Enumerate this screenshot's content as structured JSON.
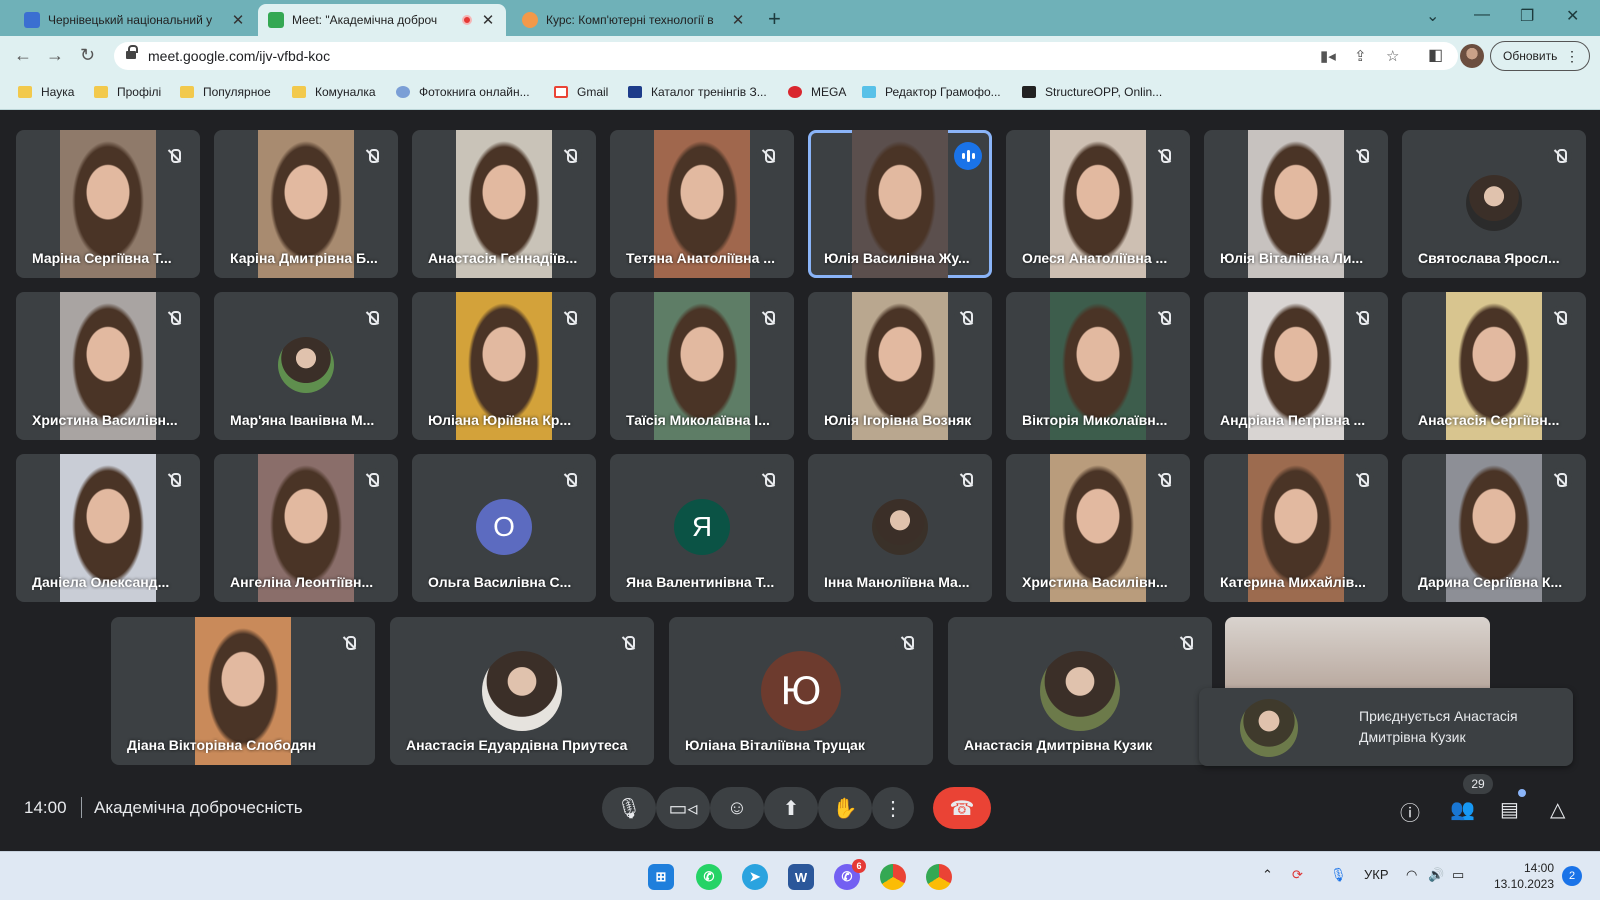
{
  "browser": {
    "tabs": [
      {
        "label": "Чернівецький національний у",
        "favicon_color": "#3b6fd1"
      },
      {
        "label": "Meet: \"Академічна доброч",
        "favicon_color": "#34a853",
        "recording": true
      },
      {
        "label": "Курс: Комп'ютерні технології в",
        "favicon_color": "#f2994a"
      }
    ],
    "url": "meet.google.com/ijv-vfbd-koc",
    "update_label": "Обновить",
    "bookmarks": [
      {
        "label": "Наука",
        "icon": "folder-icon"
      },
      {
        "label": "Профілі",
        "icon": "folder-icon"
      },
      {
        "label": "Популярное",
        "icon": "folder-icon"
      },
      {
        "label": "Комуналка",
        "icon": "folder-icon"
      },
      {
        "label": "Фотокнига онлайн...",
        "icon": "photobook-icon"
      },
      {
        "label": "Gmail",
        "icon": "gmail-icon"
      },
      {
        "label": "Каталог тренінгів З...",
        "icon": "catalog-icon"
      },
      {
        "label": "MEGA",
        "icon": "mega-icon"
      },
      {
        "label": "Редактор Грамофо...",
        "icon": "editor-icon"
      },
      {
        "label": "StructureOPP, Onlin...",
        "icon": "structure-icon"
      }
    ]
  },
  "participants": [
    {
      "name": "Маріна Сергіївна Т...",
      "muted": true,
      "kind": "video",
      "tone": "#8f7a6a"
    },
    {
      "name": "Каріна Дмитрівна Б...",
      "muted": true,
      "kind": "video",
      "tone": "#a88b70"
    },
    {
      "name": "Анастасія Геннадіїв...",
      "muted": true,
      "kind": "video",
      "tone": "#c9c3b8"
    },
    {
      "name": "Тетяна Анатоліївна ...",
      "muted": true,
      "kind": "video",
      "tone": "#a0674d"
    },
    {
      "name": "Юлія Василівна Жу...",
      "muted": false,
      "speaking": true,
      "kind": "video",
      "tone": "#5b4f4d"
    },
    {
      "name": "Олеся Анатоліївна ...",
      "muted": true,
      "kind": "video",
      "tone": "#cdbfb2"
    },
    {
      "name": "Юлія Віталіївна Ли...",
      "muted": true,
      "kind": "video",
      "tone": "#c7c2bf"
    },
    {
      "name": "Святослава Яросл...",
      "muted": true,
      "kind": "photo-avatar",
      "tone": "#2b2b2b"
    },
    {
      "name": "Христина Василівн...",
      "muted": true,
      "kind": "video",
      "tone": "#a9a4a2"
    },
    {
      "name": "Мар'яна Іванівна М...",
      "muted": true,
      "kind": "photo-avatar",
      "tone": "#5f8f4e"
    },
    {
      "name": "Юліана Юріївна Кр...",
      "muted": true,
      "kind": "video",
      "tone": "#d3a23a"
    },
    {
      "name": "Таїсія Миколаївна І...",
      "muted": true,
      "kind": "video",
      "tone": "#5e7d66"
    },
    {
      "name": "Юлія Ігорівна Возняк",
      "muted": true,
      "kind": "video",
      "tone": "#b9a78f"
    },
    {
      "name": "Вікторія Миколаївн...",
      "muted": true,
      "kind": "video",
      "tone": "#3d5d4c"
    },
    {
      "name": "Андріана Петрівна ...",
      "muted": true,
      "kind": "video",
      "tone": "#d8d4d2"
    },
    {
      "name": "Анастасія Сергіївн...",
      "muted": true,
      "kind": "video",
      "tone": "#d8c58f"
    },
    {
      "name": "Даніела Олександ...",
      "muted": true,
      "kind": "video",
      "tone": "#c9cdd6"
    },
    {
      "name": "Ангеліна Леонтіївн...",
      "muted": true,
      "kind": "video",
      "tone": "#8a6e6a"
    },
    {
      "name": "Ольга Василівна С...",
      "muted": true,
      "kind": "letter",
      "letter": "О",
      "color": "#5c6bc0"
    },
    {
      "name": "Яна Валентинівна Т...",
      "muted": true,
      "kind": "letter",
      "letter": "Я",
      "color": "#0b5345"
    },
    {
      "name": "Інна Маноліївна Ма...",
      "muted": true,
      "kind": "photo-avatar",
      "tone": "#3a3129"
    },
    {
      "name": "Христина Василівн...",
      "muted": true,
      "kind": "video",
      "tone": "#b99c7c"
    },
    {
      "name": "Катерина Михайлів...",
      "muted": true,
      "kind": "video",
      "tone": "#9c6b4f"
    },
    {
      "name": "Дарина Сергіївна К...",
      "muted": true,
      "kind": "video",
      "tone": "#8d8f96"
    },
    {
      "name": "Діана Вікторівна Слободян",
      "muted": true,
      "kind": "video",
      "tone": "#c98a5a"
    },
    {
      "name": "Анастасія Едуардівна Приутеса",
      "muted": true,
      "kind": "photo-avatar",
      "tone": "#e6e3de"
    },
    {
      "name": "Юліана Віталіївна Трущак",
      "muted": true,
      "kind": "letter",
      "letter": "Ю",
      "color": "#6d3b2e"
    },
    {
      "name": "Анастасія Дмитрівна Кузик",
      "muted": true,
      "kind": "photo-avatar",
      "tone": "#6c7a4a"
    }
  ],
  "notification": {
    "text": "Приєднується Анастасія Дмитрівна Кузик"
  },
  "meeting": {
    "time": "14:00",
    "title": "Академічна доброчесність",
    "participant_count": "29"
  },
  "taskbar": {
    "language": "УКР",
    "time": "14:00",
    "date": "13.10.2023",
    "notifications": "2",
    "viber_badge": "6"
  }
}
